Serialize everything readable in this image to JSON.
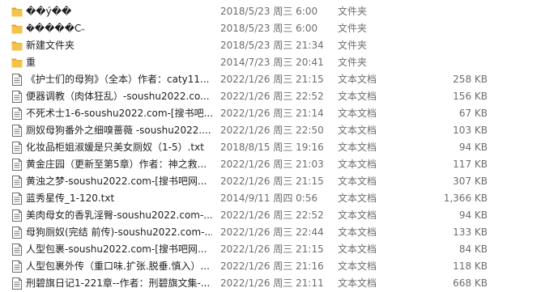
{
  "files": [
    {
      "name": "��ý��",
      "date": "2018/5/23 周三 6:00",
      "type": "文件夹",
      "size": "",
      "icon": "folder-icon"
    },
    {
      "name": "�ܳ����С˵",
      "date": "2018/5/23 周三 6:00",
      "type": "文件夹",
      "size": "",
      "icon": "folder-icon"
    },
    {
      "name": "新建文件夹",
      "date": "2018/5/23 周三 21:34",
      "type": "文件夹",
      "size": "",
      "icon": "folder-icon"
    },
    {
      "name": "重",
      "date": "2014/7/23 周三 20:41",
      "type": "文件夹",
      "size": "",
      "icon": "folder-icon"
    },
    {
      "name": "《护士们的母狗》（全本）作者：caty11...",
      "date": "2022/1/26 周三 21:15",
      "type": "文本文档",
      "size": "258 KB",
      "icon": "text-file-icon"
    },
    {
      "name": "便器调教（肉体狂乱）-soushu2022.co...",
      "date": "2022/1/26 周三 22:52",
      "type": "文本文档",
      "size": "156 KB",
      "icon": "text-file-icon"
    },
    {
      "name": "不死术士1-6-soushu2022.com-[搜书吧...",
      "date": "2022/1/26 周三 21:14",
      "type": "文本文档",
      "size": "67 KB",
      "icon": "text-file-icon"
    },
    {
      "name": "厕奴母狗番外之细嗅蔷薇 -soushu2022....",
      "date": "2022/1/26 周三 22:50",
      "type": "文本文档",
      "size": "103 KB",
      "icon": "text-file-icon"
    },
    {
      "name": "化妆品柜姐淑媛是只美女厕奴（1-5）.txt",
      "date": "2018/8/15 周三 19:16",
      "type": "文本文档",
      "size": "94 KB",
      "icon": "text-file-icon"
    },
    {
      "name": "黄金庄园（更新至第5章）作者：神之救...",
      "date": "2022/1/26 周三 21:03",
      "type": "文本文档",
      "size": "117 KB",
      "icon": "text-file-icon"
    },
    {
      "name": "黄浊之梦-soushu2022.com-[搜书吧网...",
      "date": "2022/1/26 周三 21:15",
      "type": "文本文档",
      "size": "307 KB",
      "icon": "text-file-icon"
    },
    {
      "name": "蓝秀星传_1-120.txt",
      "date": "2014/9/11 周四 0:56",
      "type": "文本文档",
      "size": "1,366 KB",
      "icon": "text-file-icon"
    },
    {
      "name": "美肉母女的香乳淫臀-soushu2022.com-...",
      "date": "2022/1/26 周三 22:52",
      "type": "文本文档",
      "size": "94 KB",
      "icon": "text-file-icon"
    },
    {
      "name": "母狗厕奴(完结 前传)-soushu2022.com-...",
      "date": "2022/1/26 周三 22:44",
      "type": "文本文档",
      "size": "133 KB",
      "icon": "text-file-icon"
    },
    {
      "name": "人型包裹-soushu2022.com-[搜书吧网...",
      "date": "2022/1/26 周三 21:15",
      "type": "文本文档",
      "size": "84 KB",
      "icon": "text-file-icon"
    },
    {
      "name": "人型包裹外传（重口味.扩张.脱垂.慎入）...",
      "date": "2022/1/26 周三 21:16",
      "type": "文本文档",
      "size": "118 KB",
      "icon": "text-file-icon"
    },
    {
      "name": "刑碧旗日记1-221章--作者：刑碧旗文集-...",
      "date": "2022/1/26 周三 21:11",
      "type": "文本文档",
      "size": "668 KB",
      "icon": "text-file-icon"
    }
  ],
  "colors": {
    "folder": "#f3c34a",
    "folder_dark": "#dba52a",
    "text_secondary": "#6d6d6d"
  }
}
